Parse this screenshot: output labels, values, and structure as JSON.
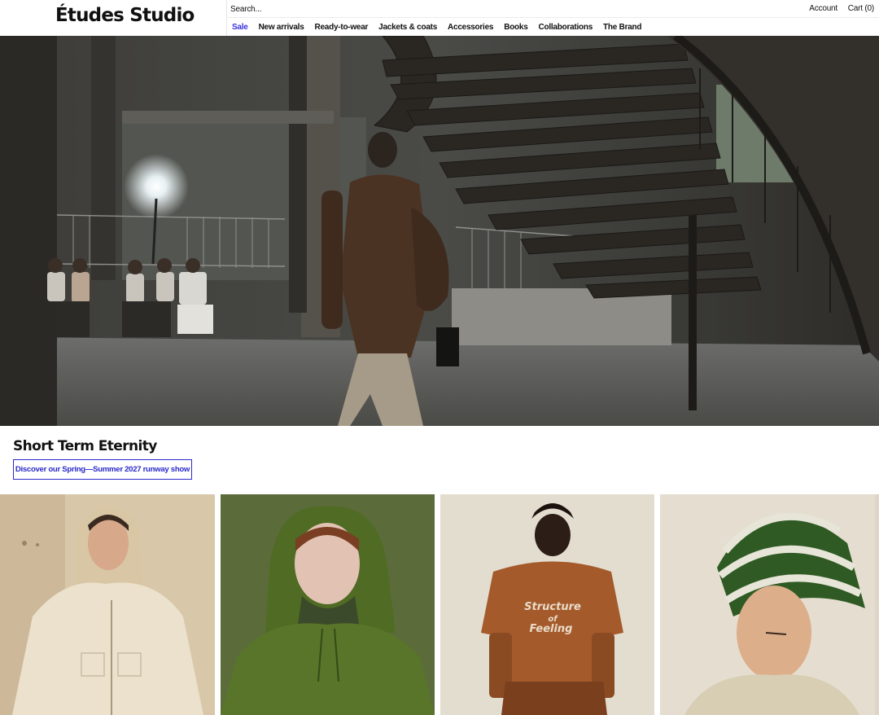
{
  "brand": {
    "logo": "Études Studio"
  },
  "search": {
    "placeholder": "Search..."
  },
  "account": {
    "account_label": "Account",
    "cart_label": "Cart (0)"
  },
  "nav": {
    "items": [
      {
        "label": "Sale",
        "highlight": "#3a2ee0"
      },
      {
        "label": "New arrivals"
      },
      {
        "label": "Ready-to-wear"
      },
      {
        "label": "Jackets & coats"
      },
      {
        "label": "Accessories"
      },
      {
        "label": "Books"
      },
      {
        "label": "Collaborations"
      },
      {
        "label": "The Brand"
      }
    ]
  },
  "hero": {
    "image": "runway-show-photo"
  },
  "campaign": {
    "title": "Short Term Eternity",
    "cta_label": "Discover our Spring—Summer 2027 runway show",
    "accent": "#2a2ac9"
  },
  "products": {
    "tshirt_print": [
      "Structure",
      "of",
      "Feeling"
    ]
  }
}
